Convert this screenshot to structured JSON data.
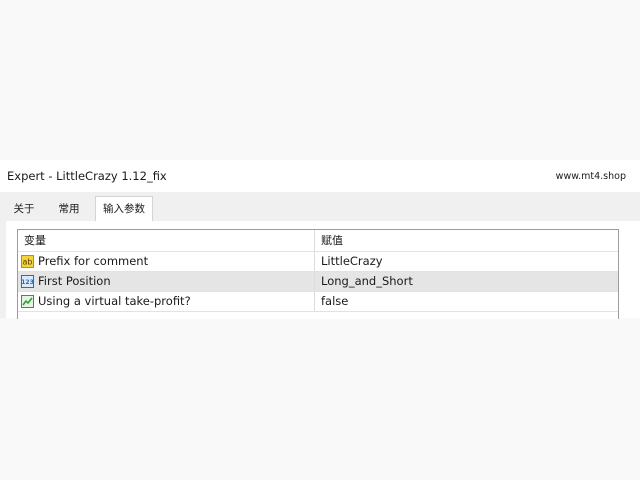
{
  "window": {
    "title": "Expert - LittleCrazy 1.12_fix",
    "brand": "www.mt4.shop"
  },
  "tabs": [
    {
      "label": "关于"
    },
    {
      "label": "常用"
    },
    {
      "label": "输入参数",
      "active": true
    }
  ],
  "table": {
    "columns": [
      "变量",
      "赋值"
    ],
    "rows": [
      {
        "icon": "ab-string-icon",
        "variable": "Prefix for comment",
        "value": "LittleCrazy"
      },
      {
        "icon": "123-integer-icon",
        "variable": "First Position",
        "value": "Long_and_Short",
        "selected": true
      },
      {
        "icon": "bool-chart-icon",
        "variable": "Using a virtual take-profit?",
        "value": "false"
      }
    ]
  },
  "colors": {
    "selected_row": "#e5e5e5",
    "grid_border": "#9c9c9c",
    "string_icon": "#e8b800",
    "integer_icon": "#1e6fc8",
    "bool_icon": "#2e9b3a"
  }
}
